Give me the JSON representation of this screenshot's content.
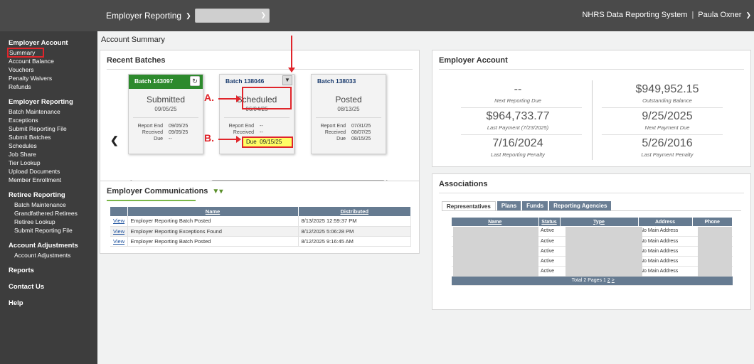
{
  "topbar": {
    "menu_label": "Employer Reporting",
    "system_name": "NHRS Data Reporting System",
    "separator": "|",
    "user_name": "Paula Oxner"
  },
  "sidebar": {
    "groups": [
      {
        "title": "Employer Account",
        "items": [
          "Summary",
          "Account Balance",
          "Vouchers",
          "Penalty Waivers",
          "Refunds"
        ]
      },
      {
        "title": "Employer Reporting",
        "items": [
          "Batch Maintenance",
          "Exceptions",
          "Submit Reporting File",
          "Submit Batches",
          "Schedules",
          "Job Share",
          "Tier Lookup",
          "Upload Documents",
          "Member Enrollment"
        ]
      },
      {
        "title": "Retiree Reporting",
        "items": [
          "Batch Maintenance",
          "Grandfathered Retirees",
          "Retiree Lookup",
          "Submit Reporting File"
        ]
      },
      {
        "title": "Account Adjustments",
        "items": [
          "Account Adjustments"
        ]
      },
      {
        "title": "Reports",
        "items": []
      },
      {
        "title": "Contact Us",
        "items": []
      },
      {
        "title": "Help",
        "items": []
      }
    ]
  },
  "main": {
    "page_title": "Account Summary"
  },
  "batches": {
    "title": "Recent Batches",
    "cards": [
      {
        "name": "Batch 143097",
        "status": "Submitted",
        "date": "09/05/25",
        "report_end_label": "Report End",
        "report_end": "09/05/25",
        "received_label": "Received",
        "received": "09/05/25",
        "due_label": "Due",
        "due": "--"
      },
      {
        "name": "Batch 138046",
        "status": "Scheduled",
        "date": "06/04/25",
        "report_end_label": "Report End",
        "report_end": "--",
        "received_label": "Received",
        "received": "--",
        "due_label": "Due",
        "due": "09/15/25"
      },
      {
        "name": "Batch 138033",
        "status": "Posted",
        "date": "08/13/25",
        "report_end_label": "Report End",
        "report_end": "07/31/25",
        "received_label": "Received",
        "received": "08/07/25",
        "due_label": "Due",
        "due": "08/15/25"
      }
    ],
    "annotation_a": "A.",
    "annotation_b": "B."
  },
  "comms": {
    "title": "Employer Communications",
    "headers": [
      "",
      "Name",
      "Distributed"
    ],
    "rows": [
      {
        "link": "View",
        "name": "Employer Reporting Batch Posted",
        "distributed": "8/13/2025 12:59:37 PM"
      },
      {
        "link": "View",
        "name": "Employer Reporting Exceptions Found",
        "distributed": "8/12/2025 5:06:28 PM"
      },
      {
        "link": "View",
        "name": "Employer Reporting Batch Posted",
        "distributed": "8/12/2025 9:16:45 AM"
      }
    ]
  },
  "account": {
    "title": "Employer Account",
    "cells": [
      {
        "value": "--",
        "label": "Next Reporting Due"
      },
      {
        "value": "$949,952.15",
        "label": "Outstanding Balance"
      },
      {
        "value": "$964,733.77",
        "label": "Last Payment (7/23/2025)"
      },
      {
        "value": "9/25/2025",
        "label": "Next Payment Due"
      },
      {
        "value": "7/16/2024",
        "label": "Last Reporting Penalty"
      },
      {
        "value": "5/26/2016",
        "label": "Last Payment Penalty"
      }
    ]
  },
  "assoc": {
    "title": "Associations",
    "tabs": [
      "Representatives",
      "Plans",
      "Funds",
      "Reporting Agencies"
    ],
    "headers": [
      "Name",
      "Status",
      "Type",
      "Address",
      "Phone"
    ],
    "rows": [
      {
        "status": "Active",
        "address": "No Main Address"
      },
      {
        "status": "Active",
        "address": "No Main Address"
      },
      {
        "status": "Active",
        "address": "No Main Address"
      },
      {
        "status": "Active",
        "address": "No Main Address"
      },
      {
        "status": "Active",
        "address": "No Main Address"
      }
    ],
    "footer_text": "Total 2 Pages",
    "page_1": "1",
    "page_2": "2",
    "page_next": ">"
  }
}
